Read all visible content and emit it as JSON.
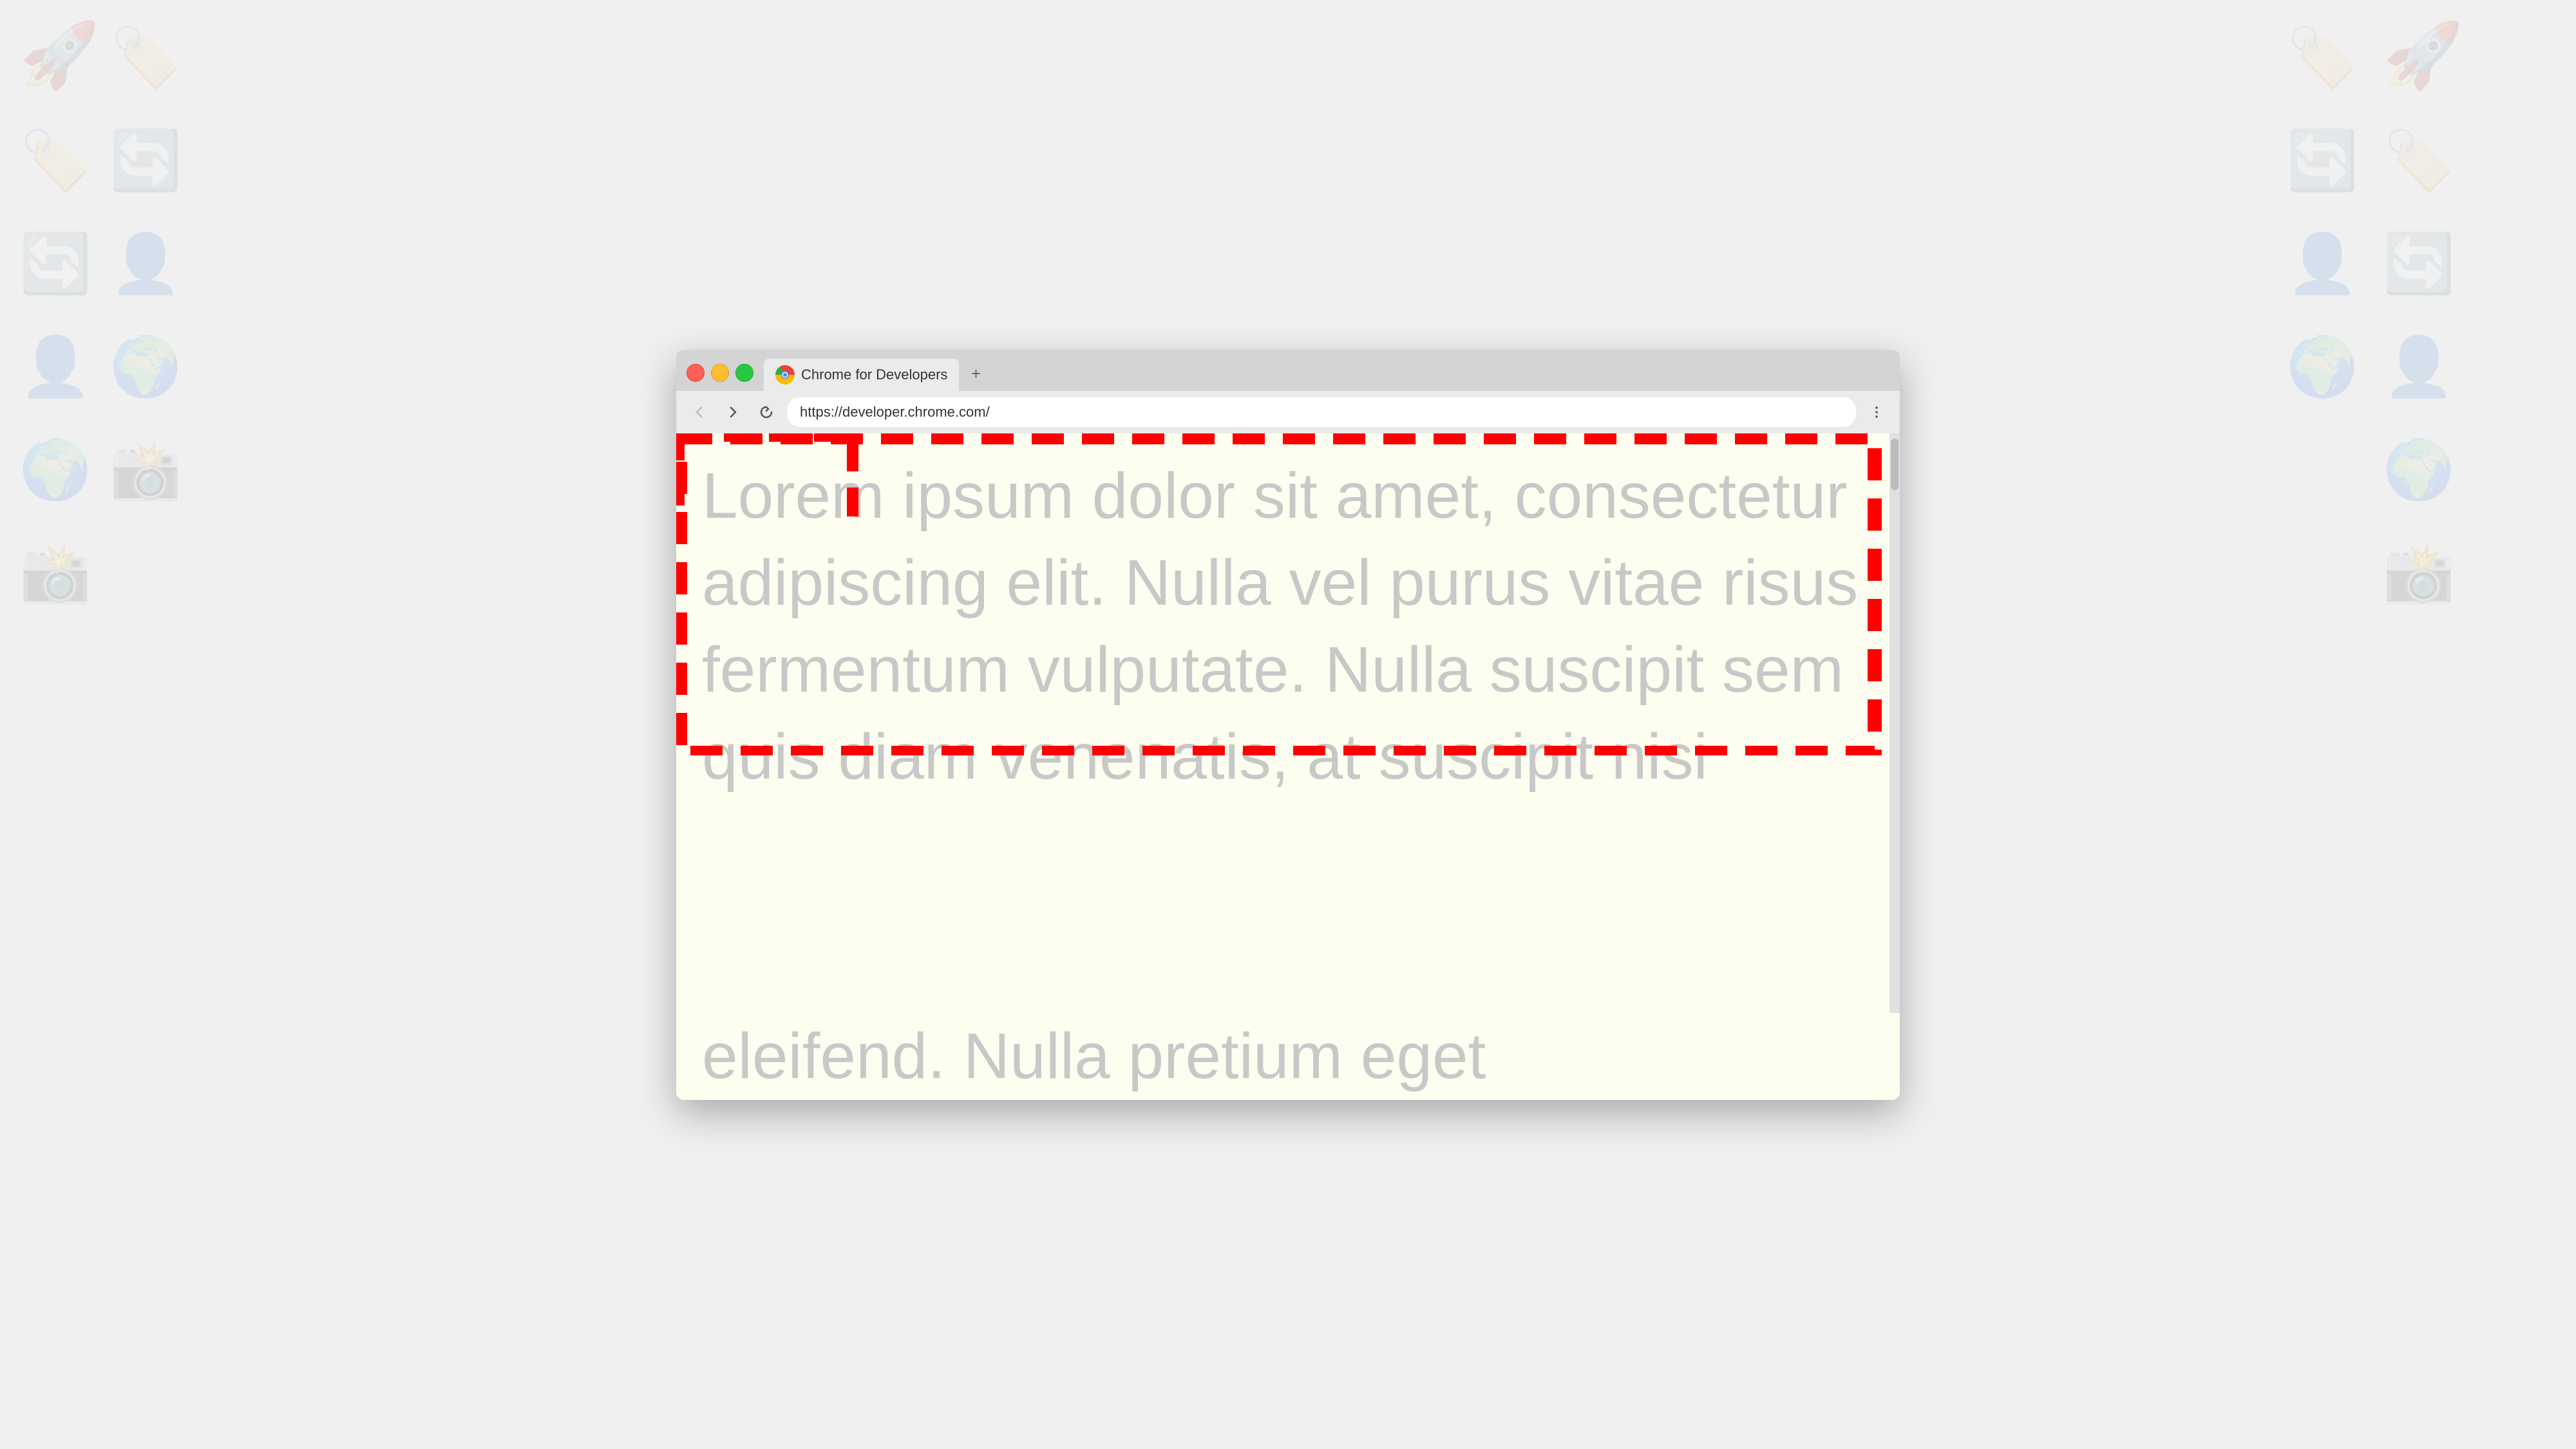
{
  "background": {
    "color": "#f0f0f0"
  },
  "browser": {
    "tab": {
      "title": "Chrome for Developers",
      "favicon_alt": "Chrome logo"
    },
    "new_tab_label": "+",
    "nav": {
      "back_label": "←",
      "forward_label": "→",
      "reload_label": "↺"
    },
    "address_bar": {
      "value": "https://developer.chrome.com/"
    },
    "menu_label": "⋮"
  },
  "page": {
    "lorem_text": "Lorem ipsum dolor sit amet, consectetur adipiscing elit. Nulla vel purus vitae risus fermentum vulputate. Nulla suscipit sem quis diam venenatis, at suscipit nisi eleifend. Nulla pretium eget",
    "bg_color": "#fefef0",
    "border_color": "#ff0000"
  }
}
